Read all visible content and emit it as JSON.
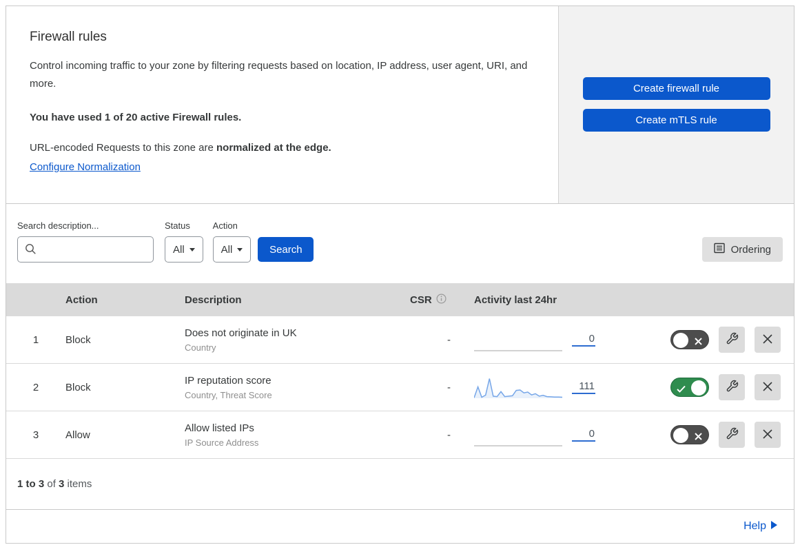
{
  "header": {
    "title": "Firewall rules",
    "description": "Control incoming traffic to your zone by filtering requests based on location, IP address, user agent, URI, and more.",
    "usage_note": "You have used 1 of 20 active Firewall rules.",
    "normalization_prefix": "URL-encoded Requests to this zone are ",
    "normalization_bold": "normalized at the edge.",
    "normalization_link": "Configure Normalization"
  },
  "actions_panel": {
    "create_firewall_rule_label": "Create firewall rule",
    "create_mtls_rule_label": "Create mTLS rule"
  },
  "filter_bar": {
    "search_label": "Search description...",
    "search_value": "",
    "status_label": "Status",
    "status_value": "All",
    "action_label": "Action",
    "action_value": "All",
    "search_button_label": "Search",
    "ordering_button_label": "Ordering"
  },
  "table": {
    "columns": {
      "action": "Action",
      "description": "Description",
      "csr": "CSR",
      "activity": "Activity last 24hr"
    },
    "rows": [
      {
        "num": "1",
        "action": "Block",
        "title": "Does not originate in UK",
        "subtitle": "Country",
        "csr": "-",
        "count": "0",
        "enabled": false,
        "sparkline": [
          0,
          0,
          0,
          0,
          0,
          0,
          0,
          0,
          0,
          0,
          0,
          0,
          0,
          0,
          0,
          0,
          0,
          0,
          0,
          0,
          0,
          0,
          0,
          0
        ]
      },
      {
        "num": "2",
        "action": "Block",
        "title": "IP reputation score",
        "subtitle": "Country, Threat Score",
        "csr": "-",
        "count": "111",
        "enabled": true,
        "sparkline": [
          2,
          55,
          5,
          15,
          95,
          10,
          8,
          32,
          8,
          10,
          12,
          38,
          40,
          26,
          30,
          16,
          22,
          10,
          14,
          8,
          7,
          6,
          6,
          5
        ]
      },
      {
        "num": "3",
        "action": "Allow",
        "title": "Allow listed IPs",
        "subtitle": "IP Source Address",
        "csr": "-",
        "count": "0",
        "enabled": false,
        "sparkline": [
          0,
          0,
          0,
          0,
          0,
          0,
          0,
          0,
          0,
          0,
          0,
          0,
          0,
          0,
          0,
          0,
          0,
          0,
          0,
          0,
          0,
          0,
          0,
          0
        ]
      }
    ]
  },
  "footer": {
    "range": "1 to 3",
    "of_text": " of ",
    "total": "3",
    "items_text": " items"
  },
  "help": {
    "label": "Help"
  },
  "colors": {
    "primary_blue": "#0b58cc",
    "toggle_green": "#2f8c4e",
    "toggle_off_gray": "#4d4d4d",
    "sparkline_blue": "#76a6e8",
    "header_gray": "#dadada",
    "panel_gray": "#f2f2f2"
  }
}
